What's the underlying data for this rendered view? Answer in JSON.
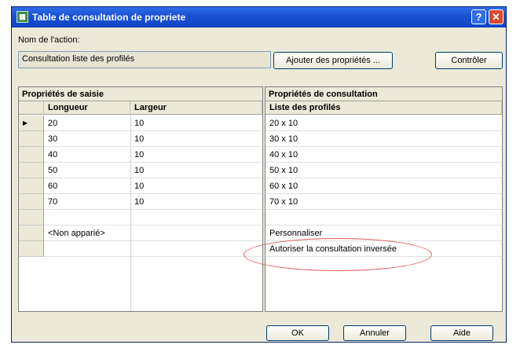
{
  "window": {
    "title": "Table de consultation de propriete",
    "app_icon": "table-icon",
    "help_label": "?",
    "close_label": "✕"
  },
  "action": {
    "name_label": "Nom de l'action:",
    "name_value": "Consultation liste des profilés",
    "add_button": "Ajouter des propriétés ...",
    "control_button": "Contrôler"
  },
  "input_grid": {
    "title": "Propriétés de saisie",
    "columns": [
      "Longueur",
      "Largeur"
    ],
    "current_row_marker": "▶",
    "rows": [
      {
        "longueur": "20",
        "largeur": "10"
      },
      {
        "longueur": "30",
        "largeur": "10"
      },
      {
        "longueur": "40",
        "largeur": "10"
      },
      {
        "longueur": "50",
        "largeur": "10"
      },
      {
        "longueur": "60",
        "largeur": "10"
      },
      {
        "longueur": "70",
        "largeur": "10"
      },
      {
        "longueur": "",
        "largeur": ""
      },
      {
        "longueur": "<Non apparié>",
        "largeur": ""
      },
      {
        "longueur": "",
        "largeur": ""
      }
    ]
  },
  "lookup_grid": {
    "title": "Propriétés de consultation",
    "column": "Liste des profilés",
    "rows": [
      "20 x 10",
      "30 x 10",
      "40 x 10",
      "50 x 10",
      "60 x 10",
      "70 x 10",
      "",
      "Personnaliser",
      "Autoriser la consultation inversée"
    ]
  },
  "footer": {
    "ok": "OK",
    "cancel": "Annuler",
    "help": "Aide"
  },
  "colors": {
    "titlebar": "#1a52d4",
    "dialog_bg": "#ece9d8",
    "highlight_ellipse": "#e05a5a"
  }
}
